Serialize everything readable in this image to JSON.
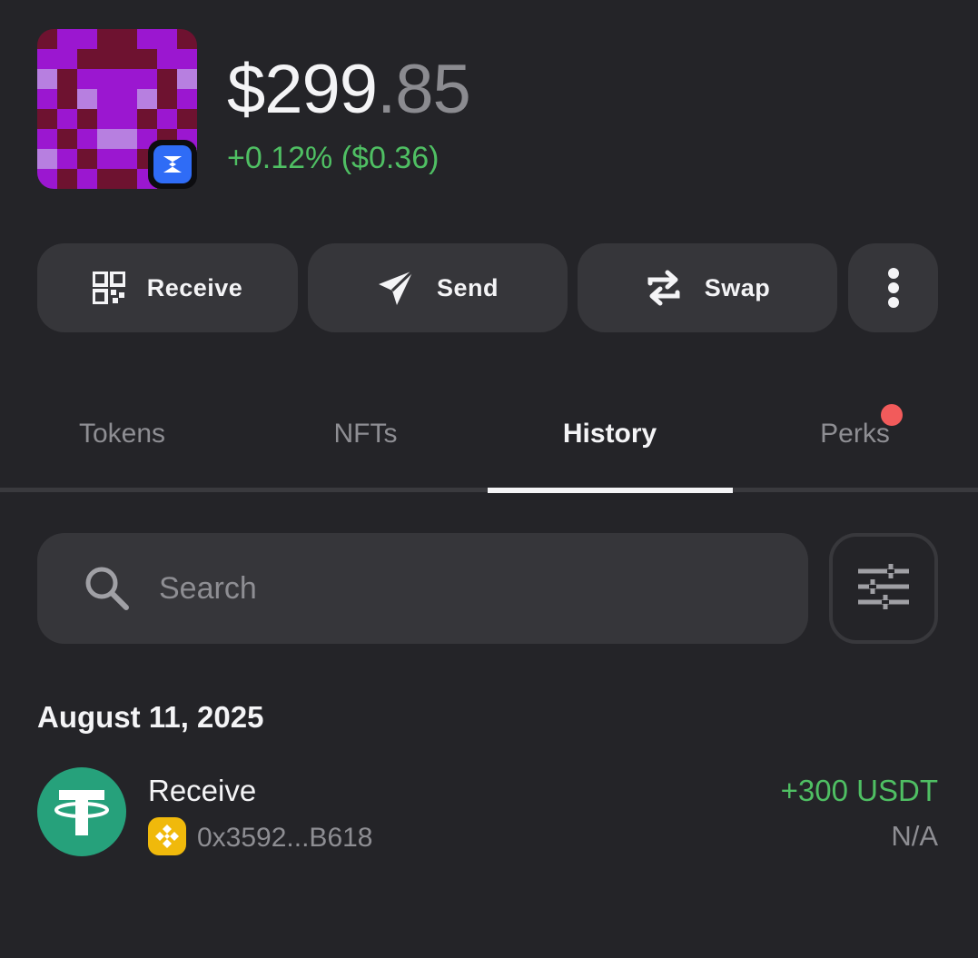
{
  "header": {
    "balance_integer": "$299",
    "balance_decimal": ".85",
    "change": "+0.12% ($0.36)",
    "avatar_icon": "pixel-art-avatar",
    "chain_badge_icon": "zksync-icon"
  },
  "actions": [
    {
      "label": "Receive",
      "icon": "qr-code-icon"
    },
    {
      "label": "Send",
      "icon": "send-arrow-icon"
    },
    {
      "label": "Swap",
      "icon": "swap-arrows-icon"
    },
    {
      "label": "",
      "icon": "more-vertical-icon"
    }
  ],
  "tabs": [
    {
      "label": "Tokens",
      "active": false
    },
    {
      "label": "NFTs",
      "active": false
    },
    {
      "label": "History",
      "active": true
    },
    {
      "label": "Perks",
      "active": false,
      "notification_dot": true
    }
  ],
  "search": {
    "placeholder": "Search",
    "value": ""
  },
  "history": {
    "groups": [
      {
        "date": "August 11, 2025",
        "transactions": [
          {
            "type": "Receive",
            "token_icon": "tether-icon",
            "chain_icon": "bnb-chain-icon",
            "address": "0x3592...B618",
            "amount": "+300 USDT",
            "fiat": "N/A"
          }
        ]
      }
    ]
  },
  "colors": {
    "background": "#242428",
    "surface": "#36363a",
    "positive": "#4fbf63",
    "muted": "#8e8e93",
    "tether": "#26a17b",
    "bnb": "#f0b90b",
    "notification": "#f25b5b"
  }
}
